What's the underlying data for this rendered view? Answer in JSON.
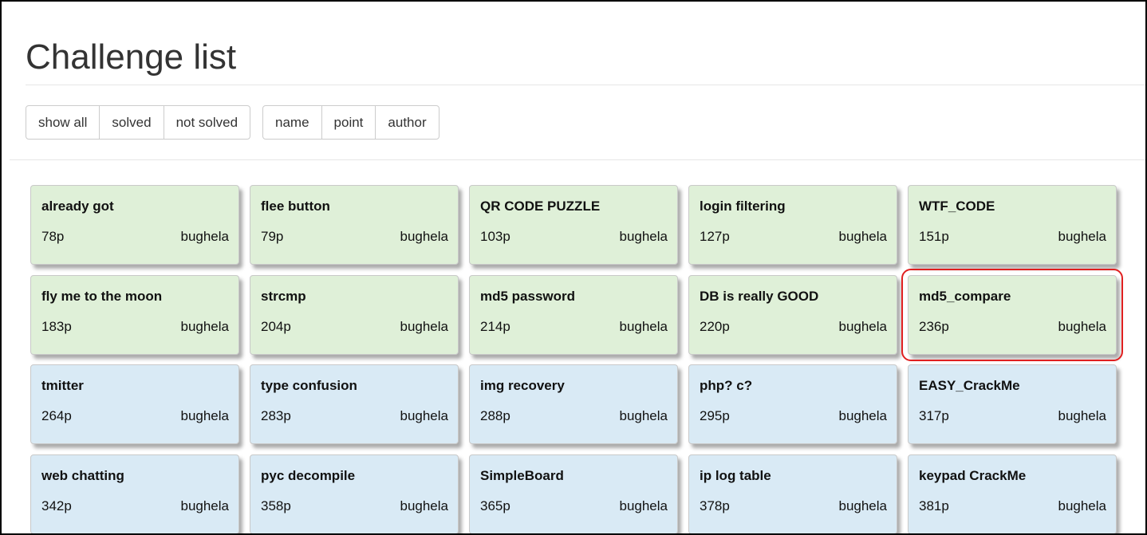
{
  "page": {
    "title": "Challenge list"
  },
  "filters": {
    "show_all": "show all",
    "solved": "solved",
    "not_solved": "not solved"
  },
  "sort": {
    "name": "name",
    "point": "point",
    "author": "author"
  },
  "colors": {
    "solved_bg": "#dff0d8",
    "unsolved_bg": "#d9eaf5",
    "highlight": "#e02020"
  },
  "challenges": [
    {
      "name": "already got",
      "points": "78p",
      "author": "bughela",
      "status": "solved"
    },
    {
      "name": "flee button",
      "points": "79p",
      "author": "bughela",
      "status": "solved"
    },
    {
      "name": "QR CODE PUZZLE",
      "points": "103p",
      "author": "bughela",
      "status": "solved"
    },
    {
      "name": "login filtering",
      "points": "127p",
      "author": "bughela",
      "status": "solved"
    },
    {
      "name": "WTF_CODE",
      "points": "151p",
      "author": "bughela",
      "status": "solved"
    },
    {
      "name": "fly me to the moon",
      "points": "183p",
      "author": "bughela",
      "status": "solved"
    },
    {
      "name": "strcmp",
      "points": "204p",
      "author": "bughela",
      "status": "solved"
    },
    {
      "name": "md5 password",
      "points": "214p",
      "author": "bughela",
      "status": "solved"
    },
    {
      "name": "DB is really GOOD",
      "points": "220p",
      "author": "bughela",
      "status": "solved"
    },
    {
      "name": "md5_compare",
      "points": "236p",
      "author": "bughela",
      "status": "solved",
      "highlighted": true
    },
    {
      "name": "tmitter",
      "points": "264p",
      "author": "bughela",
      "status": "unsolved"
    },
    {
      "name": "type confusion",
      "points": "283p",
      "author": "bughela",
      "status": "unsolved"
    },
    {
      "name": "img recovery",
      "points": "288p",
      "author": "bughela",
      "status": "unsolved"
    },
    {
      "name": "php? c?",
      "points": "295p",
      "author": "bughela",
      "status": "unsolved"
    },
    {
      "name": "EASY_CrackMe",
      "points": "317p",
      "author": "bughela",
      "status": "unsolved"
    },
    {
      "name": "web chatting",
      "points": "342p",
      "author": "bughela",
      "status": "unsolved"
    },
    {
      "name": "pyc decompile",
      "points": "358p",
      "author": "bughela",
      "status": "unsolved"
    },
    {
      "name": "SimpleBoard",
      "points": "365p",
      "author": "bughela",
      "status": "unsolved"
    },
    {
      "name": "ip log table",
      "points": "378p",
      "author": "bughela",
      "status": "unsolved"
    },
    {
      "name": "keypad CrackMe",
      "points": "381p",
      "author": "bughela",
      "status": "unsolved"
    }
  ]
}
